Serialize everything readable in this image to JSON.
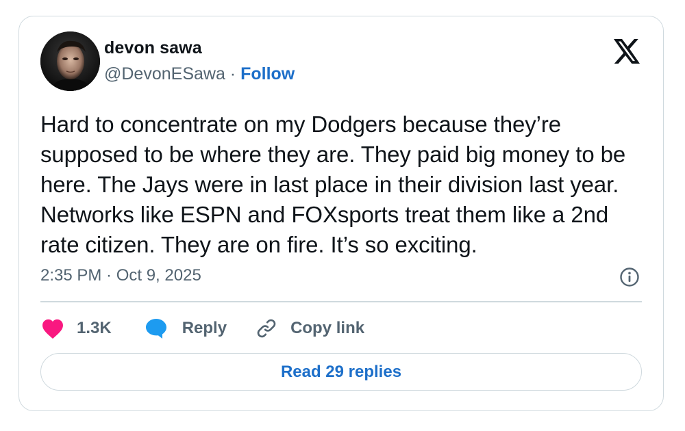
{
  "author": {
    "name": "devon sawa",
    "handle": "@DevonESawa",
    "separator": " · ",
    "follow_label": "Follow"
  },
  "tweet": {
    "text": "Hard to concentrate on my Dodgers because they’re supposed to be where they are. They paid big money to be here. The Jays were in last place in their division last year. Networks like ESPN and FOXsports treat them like a 2nd rate citizen. They are on fire. It’s so exciting.",
    "timestamp": "2:35 PM · Oct 9, 2025"
  },
  "actions": {
    "like_count": "1.3K",
    "reply_label": "Reply",
    "copy_link_label": "Copy link"
  },
  "read_replies_label": "Read 29 replies",
  "icons": {
    "logo": "x-logo-icon",
    "info": "info-icon",
    "like": "heart-icon",
    "reply": "speech-bubble-icon",
    "copy": "link-icon"
  },
  "colors": {
    "like": "#f91880",
    "reply": "#1d9bf0",
    "link": "#1d6fc9",
    "secondary_text": "#536471",
    "border": "#cfd9de"
  }
}
